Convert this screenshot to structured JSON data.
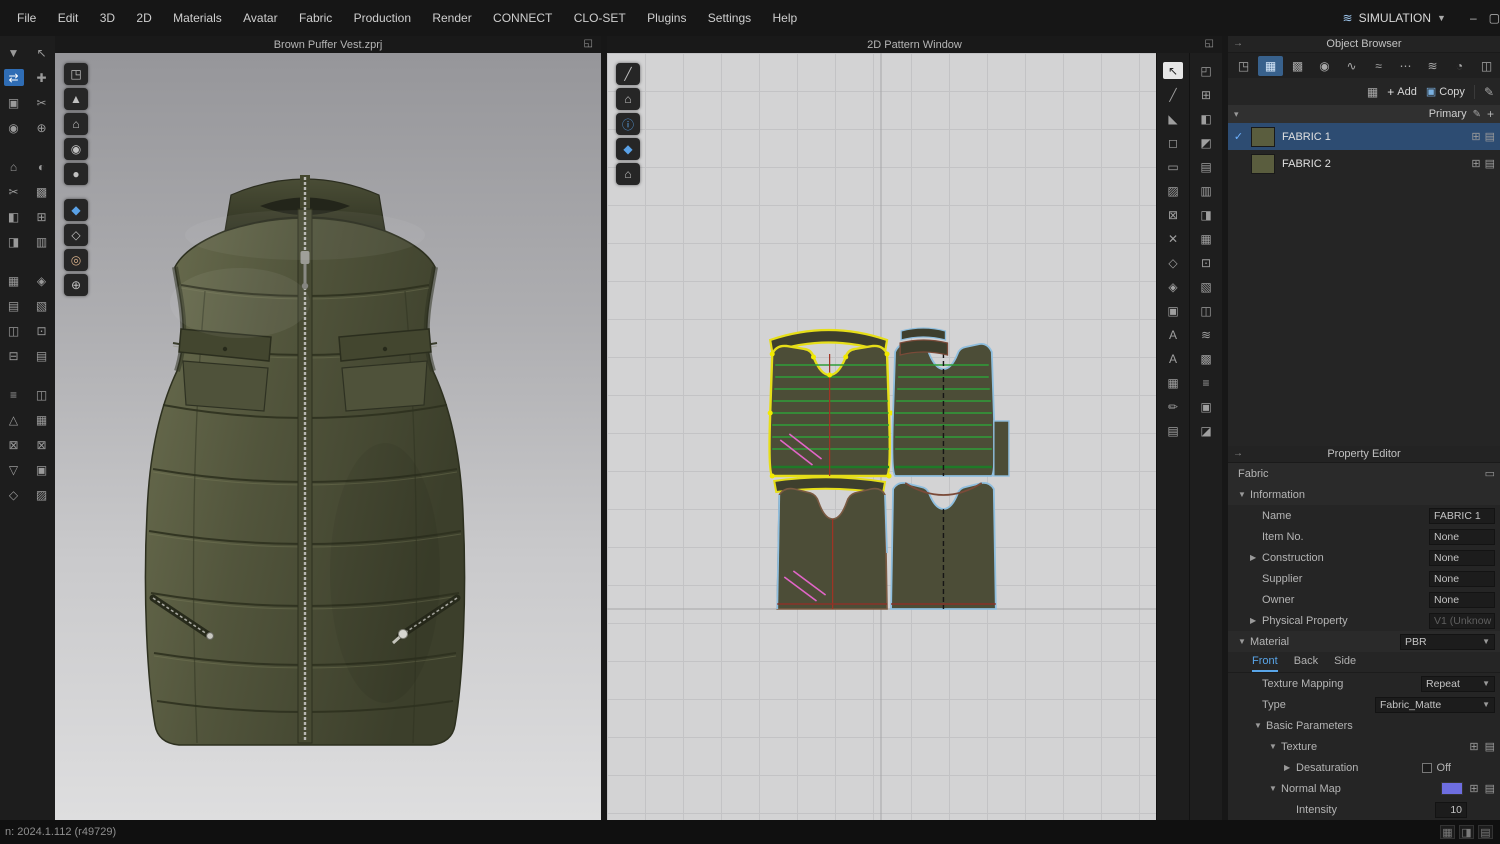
{
  "colors": {
    "accent_blue": "#4da3ff",
    "selection_blue": "#2d4c72",
    "fabric_swatch_olive": "#5a5d3e",
    "normal_map_swatch": "#6e6ee0",
    "pattern_highlight_yellow": "#e6de18",
    "pattern_outline_blue": "#8fbede",
    "vest_olive": "#4c4f38"
  },
  "menubar": {
    "items": [
      "File",
      "Edit",
      "3D",
      "2D",
      "Materials",
      "Avatar",
      "Fabric",
      "Production",
      "Render",
      "CONNECT",
      "CLO-SET",
      "Plugins",
      "Settings",
      "Help"
    ],
    "simulation_label": "SIMULATION"
  },
  "left_toolbar": {
    "col1": [
      {
        "g": "▼"
      },
      {
        "g": "⇄",
        "sel": true
      },
      {
        "g": "▣"
      },
      {
        "g": "◉"
      },
      {
        "g": "",
        "gap": true
      },
      {
        "g": "⌂"
      },
      {
        "g": "✂"
      },
      {
        "g": "◧"
      },
      {
        "g": "◨"
      },
      {
        "g": "",
        "gap": true
      },
      {
        "g": "▦"
      },
      {
        "g": "▤"
      },
      {
        "g": "◫"
      },
      {
        "g": "⊟"
      },
      {
        "g": "",
        "gap": true
      },
      {
        "g": "≡"
      },
      {
        "g": "△"
      },
      {
        "g": "⊠"
      },
      {
        "g": "▽"
      },
      {
        "g": "◇"
      }
    ],
    "col2": [
      {
        "g": "↖"
      },
      {
        "g": "✚"
      },
      {
        "g": "✂"
      },
      {
        "g": "⊕"
      },
      {
        "g": "",
        "gap": true
      },
      {
        "g": "◐"
      },
      {
        "g": "▩"
      },
      {
        "g": "⊞"
      },
      {
        "g": "▥"
      },
      {
        "g": "",
        "gap": true
      },
      {
        "g": "◈"
      },
      {
        "g": "▧"
      },
      {
        "g": "⊡"
      },
      {
        "g": "▤"
      },
      {
        "g": "",
        "gap": true
      },
      {
        "g": "◫"
      },
      {
        "g": "▦"
      },
      {
        "g": "⊠"
      },
      {
        "g": "▣"
      },
      {
        "g": "▨"
      }
    ]
  },
  "viewport3d": {
    "title": "Brown Puffer Vest.zprj",
    "tools": [
      {
        "g": "◳"
      },
      {
        "g": "▲"
      },
      {
        "g": "⌂"
      },
      {
        "g": "◉"
      },
      {
        "g": "●"
      },
      {
        "g": "",
        "gap": true
      },
      {
        "g": "◆",
        "blue": true
      },
      {
        "g": "◇"
      },
      {
        "g": "◎",
        "tan": true
      },
      {
        "g": "⊕"
      }
    ]
  },
  "viewport2d": {
    "title": "2D Pattern Window",
    "tools": [
      {
        "g": "╱"
      },
      {
        "g": "⌂"
      },
      {
        "g": "ⓘ",
        "blue": true
      },
      {
        "g": "◆",
        "blue": true
      },
      {
        "g": "⌂"
      }
    ],
    "strip1": [
      {
        "g": "↖",
        "sel": true
      },
      {
        "g": "╱"
      },
      {
        "g": "◣"
      },
      {
        "g": "◻"
      },
      {
        "g": "▭"
      },
      {
        "g": "▨"
      },
      {
        "g": "⊠"
      },
      {
        "g": "✕"
      },
      {
        "g": "◇"
      },
      {
        "g": "◈"
      },
      {
        "g": "▣"
      },
      {
        "g": "A"
      },
      {
        "g": "A"
      },
      {
        "g": "▦"
      },
      {
        "g": "✏"
      },
      {
        "g": "▤"
      }
    ],
    "strip2": [
      {
        "g": "◰"
      },
      {
        "g": "⊞"
      },
      {
        "g": "◧"
      },
      {
        "g": "◩"
      },
      {
        "g": "▤"
      },
      {
        "g": "▥"
      },
      {
        "g": "◨"
      },
      {
        "g": "▦"
      },
      {
        "g": "⊡"
      },
      {
        "g": "▧"
      },
      {
        "g": "◫"
      },
      {
        "g": "≋"
      },
      {
        "g": "▩"
      },
      {
        "g": "≡"
      },
      {
        "g": "▣"
      },
      {
        "g": "◪"
      }
    ]
  },
  "object_browser": {
    "title": "Object Browser",
    "tabs": [
      {
        "g": "◳"
      },
      {
        "g": "▦",
        "sel": true
      },
      {
        "g": "▩"
      },
      {
        "g": "◉"
      },
      {
        "g": "∿"
      },
      {
        "g": "≈"
      },
      {
        "g": "⋯"
      },
      {
        "g": "≋"
      },
      {
        "g": "◔"
      },
      {
        "g": "◫"
      }
    ],
    "overflow_glyph": "»",
    "add_label": "Add",
    "copy_label": "Copy",
    "group_label": "Primary",
    "fabrics": [
      {
        "name": "FABRIC 1",
        "sel": true,
        "check": "✓"
      },
      {
        "name": "FABRIC 2",
        "sel": false,
        "check": ""
      }
    ]
  },
  "property_editor": {
    "title": "Property Editor",
    "section_label": "Fabric",
    "information": {
      "label": "Information",
      "rows": [
        {
          "arrow": "",
          "label": "Name",
          "value": "FABRIC 1"
        },
        {
          "arrow": "",
          "label": "Item No.",
          "value": "None"
        },
        {
          "arrow": "▶",
          "label": "Construction",
          "value": "None"
        },
        {
          "arrow": "",
          "label": "Supplier",
          "value": "None"
        },
        {
          "arrow": "",
          "label": "Owner",
          "value": "None"
        },
        {
          "arrow": "▶",
          "label": "Physical Property",
          "value": "V1 (Unknow",
          "dis": true
        }
      ]
    },
    "material": {
      "label": "Material",
      "shader_value": "PBR",
      "tabs": [
        {
          "label": "Front",
          "sel": true
        },
        {
          "label": "Back",
          "sel": false
        },
        {
          "label": "Side",
          "sel": false
        }
      ],
      "texture_mapping_label": "Texture Mapping",
      "texture_mapping_value": "Repeat",
      "type_label": "Type",
      "type_value": "Fabric_Matte",
      "basic_parameters_label": "Basic Parameters",
      "texture_label": "Texture",
      "desaturation_label": "Desaturation",
      "desaturation_value": "Off",
      "normal_map_label": "Normal Map",
      "intensity_label": "Intensity",
      "intensity_value": "10"
    }
  },
  "statusbar": {
    "version": "n: 2024.1.112 (r49729)"
  }
}
